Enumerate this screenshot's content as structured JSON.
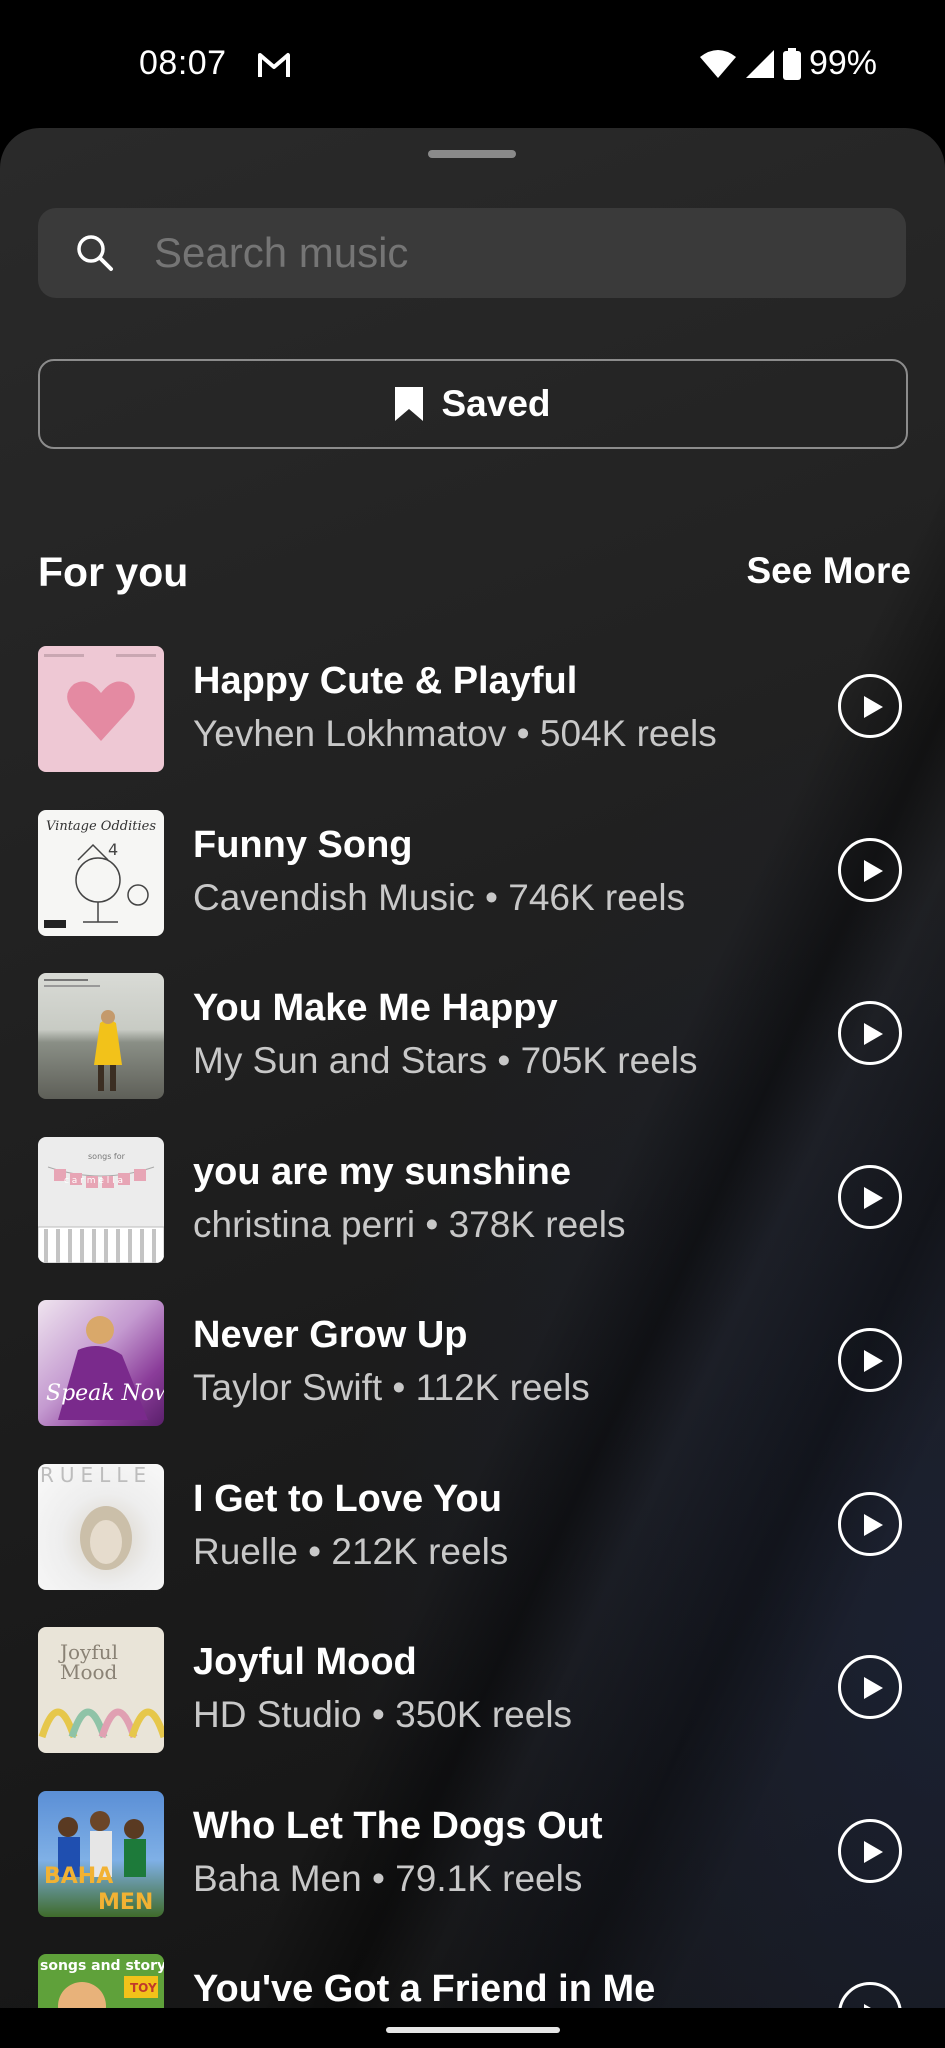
{
  "status": {
    "time": "08:07",
    "battery": "99%"
  },
  "search": {
    "placeholder": "Search music"
  },
  "saved": {
    "label": "Saved"
  },
  "section": {
    "title": "For you",
    "see_more": "See More"
  },
  "tracks": [
    {
      "title": "Happy Cute & Playful",
      "subtitle": "Yevhen Lokhmatov • 504K reels"
    },
    {
      "title": "Funny Song",
      "subtitle": "Cavendish Music • 746K reels"
    },
    {
      "title": "You Make Me Happy",
      "subtitle": "My Sun and Stars • 705K reels"
    },
    {
      "title": "you are my sunshine",
      "subtitle": "christina perri • 378K reels"
    },
    {
      "title": "Never Grow Up",
      "subtitle": "Taylor Swift • 112K reels"
    },
    {
      "title": "I Get to Love You",
      "subtitle": "Ruelle • 212K reels"
    },
    {
      "title": "Joyful Mood",
      "subtitle": "HD Studio • 350K reels"
    },
    {
      "title": "Who Let The Dogs Out",
      "subtitle": "Baha Men • 79.1K reels"
    },
    {
      "title": "You've Got a Friend in Me",
      "subtitle": ""
    }
  ],
  "cover_art": {
    "0": {
      "text": ""
    },
    "1": {
      "text": "Vintage Oddities"
    },
    "3": {
      "text": "carmella"
    },
    "4": {
      "text": "Speak Now"
    },
    "5": {
      "text": "RUELLE"
    },
    "6": {
      "text": "Joyful Mood"
    },
    "7": {
      "text": "BAHA MEN"
    },
    "8": {
      "text": "songs and story"
    }
  },
  "colors": {
    "background": "#000000",
    "sheet": "#232323",
    "search_bg": "#3a3a3a",
    "secondary_text": "#c8c8c8"
  },
  "icons": [
    "gmail-icon",
    "wifi-icon",
    "cell-signal-icon",
    "battery-icon",
    "search-icon",
    "bookmark-icon",
    "play-icon"
  ]
}
